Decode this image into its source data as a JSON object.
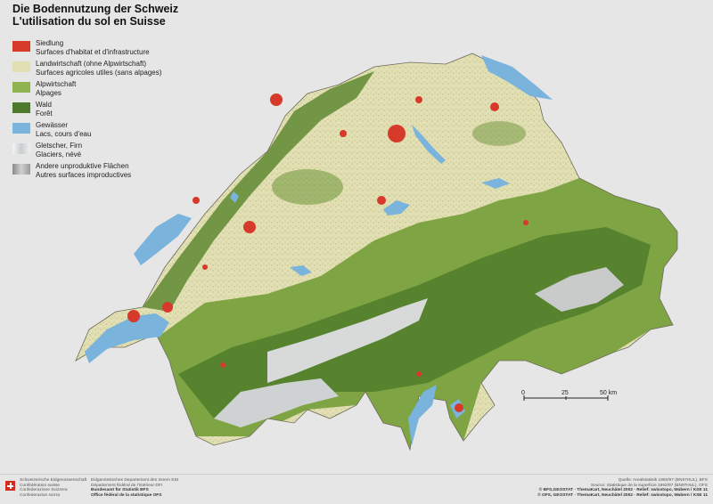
{
  "title": {
    "de": "Die Bodennutzung der Schweiz",
    "fr": "L'utilisation du sol en Suisse"
  },
  "legend": [
    {
      "label_de": "Siedlung",
      "label_fr": "Surfaces d'habitat et d'infrastructure",
      "color": "#d63a2a"
    },
    {
      "label_de": "Landwirtschaft (ohne Alpwirtschaft)",
      "label_fr": "Surfaces agricoles utiles (sans alpages)",
      "color": "#e3dfb4"
    },
    {
      "label_de": "Alpwirtschaft",
      "label_fr": "Alpages",
      "color": "#8fb44f"
    },
    {
      "label_de": "Wald",
      "label_fr": "Forêt",
      "color": "#4d7a2a"
    },
    {
      "label_de": "Gewässer",
      "label_fr": "Lacs, cours d'eau",
      "color": "#7ab3dc"
    },
    {
      "label_de": "Gletscher, Firn",
      "label_fr": "Glaciers, névé",
      "color": "#eef0f0"
    },
    {
      "label_de": "Andere unproduktive Flächen",
      "label_fr": "Autres surfaces improductives",
      "color": "#a9a9a9"
    }
  ],
  "scalebar": {
    "labels": [
      "0",
      "25",
      "50 km"
    ]
  },
  "footer": {
    "confederation": [
      "Schweizerische Eidgenossenschaft",
      "Confédération suisse",
      "Confederazione Svizzera",
      "Confederaziun svizra"
    ],
    "department": [
      "Eidgenössisches Departement des Innern EDI",
      "Département fédéral de l'intérieur DFI",
      "Bundesamt für Statistik BFS",
      "Office fédéral de la statistique OFS"
    ],
    "source": [
      "Quelle: Arealstatistik 1992/97 (BN97HUL), BFS",
      "Source: Statistique de la superficie 1992/97 (BN97HUL), OFS",
      "© BFS,GEOSTAT · ThemaKart, Neuchâtel 2002 · Relief: swisstopo, Wabern / KSE 11",
      "© OFS, GEOSTAT · ThemaKart, Neuchâtel 2002 · Relief: swisstopo, Wabern / KSE 11"
    ]
  },
  "colors": {
    "settlement": "#d63a2a",
    "agriculture": "#e3dfb4",
    "alpine": "#8fb44f",
    "forest": "#4d7a2a",
    "water": "#7ab3dc",
    "glacier": "#eef0f0",
    "unproductive": "#a9a9a9"
  }
}
